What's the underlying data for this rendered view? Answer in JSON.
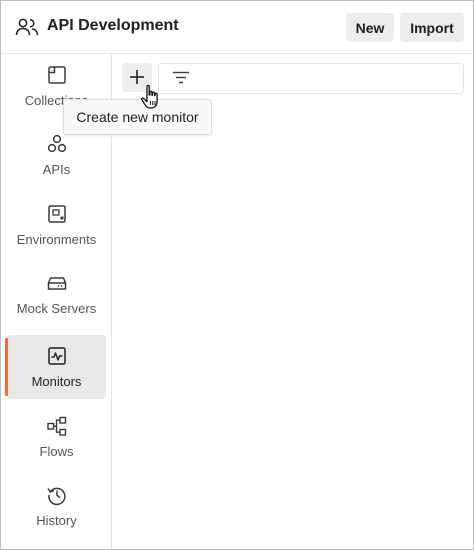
{
  "header": {
    "workspace_title": "API Development",
    "new_label": "New",
    "import_label": "Import"
  },
  "sidebar": {
    "items": [
      {
        "label": "Collections",
        "icon": "collections-icon"
      },
      {
        "label": "APIs",
        "icon": "apis-icon"
      },
      {
        "label": "Environments",
        "icon": "environments-icon"
      },
      {
        "label": "Mock Servers",
        "icon": "mock-servers-icon"
      },
      {
        "label": "Monitors",
        "icon": "monitors-icon",
        "active": true
      },
      {
        "label": "Flows",
        "icon": "flows-icon"
      },
      {
        "label": "History",
        "icon": "history-icon"
      }
    ]
  },
  "main": {
    "add_button_icon": "plus-icon",
    "filter_icon": "filter-icon",
    "tooltip": "Create new monitor"
  },
  "colors": {
    "accent": "#f26b3a",
    "button_bg": "#ededed",
    "active_bg": "#e8e8e8"
  }
}
